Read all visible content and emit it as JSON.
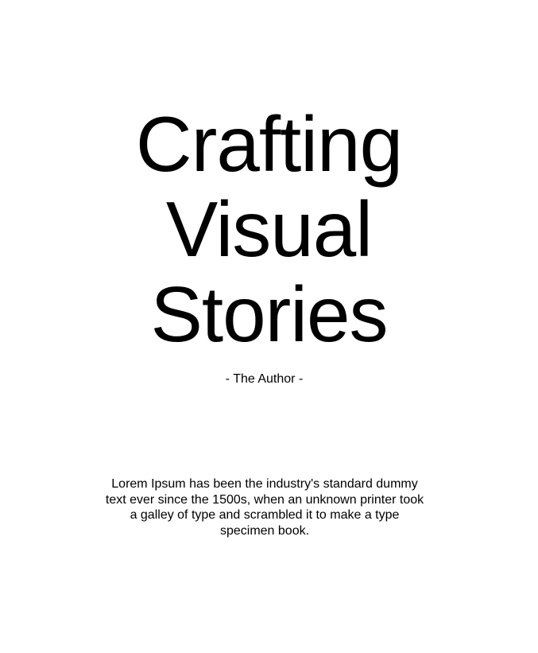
{
  "cover": {
    "title_lines": [
      "Crafting",
      "Visual",
      "Stories"
    ],
    "author": "- The Author -",
    "blurb": "Lorem Ipsum has been the industry's standard dummy text ever since the 1500s, when an unknown printer took a galley of type and scrambled it to make a type specimen book."
  }
}
